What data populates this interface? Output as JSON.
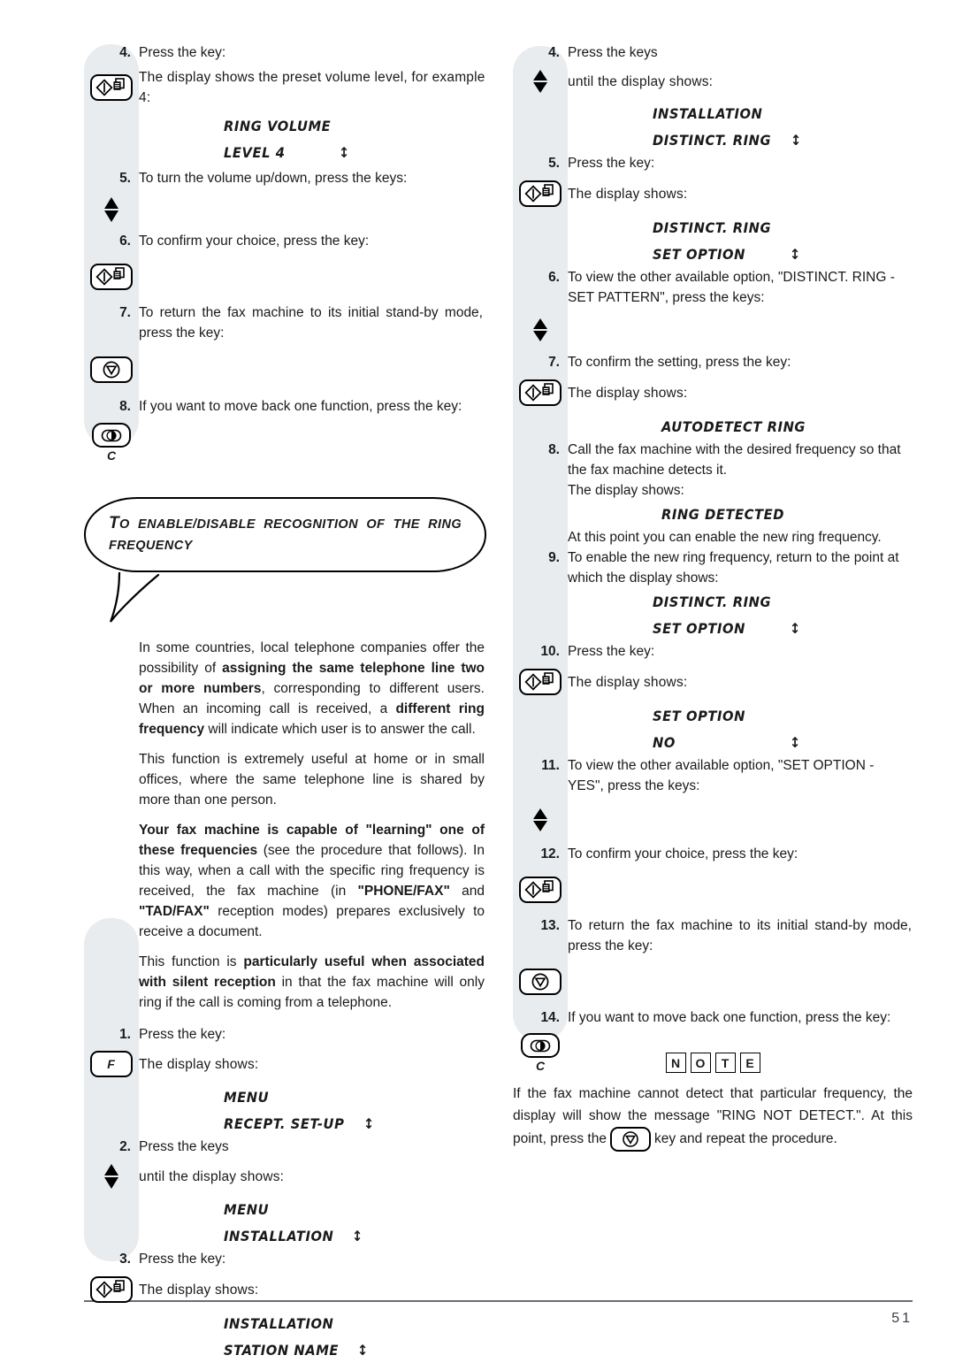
{
  "page": {
    "number": "51"
  },
  "left_column": {
    "steps": [
      {
        "num": "4.",
        "text": "Press the key:",
        "key_icon": "start-copy-key",
        "key_text": "The display shows the preset volume level, for example 4:",
        "display": [
          {
            "text": "RING VOLUME",
            "arrow": ""
          },
          {
            "text": "LEVEL 4",
            "arrow": "↕"
          }
        ]
      },
      {
        "num": "5.",
        "text": "To turn the volume up/down, press the keys:",
        "key_icon": "up-down-arrow-keys",
        "key_text": "",
        "display": []
      },
      {
        "num": "6.",
        "text": "To confirm your choice, press the key:",
        "key_icon": "start-copy-key",
        "key_text": "",
        "display": []
      },
      {
        "num": "7.",
        "text": "To return the fax machine to its initial stand-by mode, press the key:",
        "key_icon": "stop-key",
        "key_text": "",
        "display": []
      },
      {
        "num": "8.",
        "text": "If you want to move back one function, press the key:",
        "key_icon": "c-clear-key",
        "key_text": "",
        "display": []
      }
    ],
    "bubble_title_first_letter": "T",
    "bubble_title_rest": "O ENABLE/DISABLE RECOGNITION OF THE RING FREQUENCY",
    "paragraphs": [
      [
        {
          "t": "In some countries, local telephone companies offer the possibility of ",
          "b": false
        },
        {
          "t": "assigning the same telephone line two or more numbers",
          "b": true
        },
        {
          "t": ", corresponding to different users. When an incoming call is received, a ",
          "b": false
        },
        {
          "t": "different ring frequency",
          "b": true
        },
        {
          "t": " will indicate which user is to answer the call.",
          "b": false
        }
      ],
      [
        {
          "t": "This function is extremely useful at home or in small offices, where the same telephone line is shared by more than one person.",
          "b": false
        }
      ],
      [
        {
          "t": "Your fax machine is capable of \"learning\" one of these frequencies",
          "b": true
        },
        {
          "t": " (see the procedure that follows). In this way, when a call with the specific ring frequency is received, the fax machine (in ",
          "b": false
        },
        {
          "t": "\"PHONE/FAX\"",
          "b": true
        },
        {
          "t": " and ",
          "b": false
        },
        {
          "t": "\"TAD/FAX\"",
          "b": true
        },
        {
          "t": " reception modes) prepares exclusively to receive a document.",
          "b": false
        }
      ],
      [
        {
          "t": "This function is ",
          "b": false
        },
        {
          "t": "particularly useful when associated with silent reception",
          "b": true
        },
        {
          "t": " in that the fax machine will only ring if the call is coming from a telephone.",
          "b": false
        }
      ]
    ],
    "steps2": [
      {
        "num": "1.",
        "text": "Press the key:",
        "key_icon": "f-function-key",
        "key_text": "The display shows:",
        "display": [
          {
            "text": "MENU",
            "arrow": ""
          },
          {
            "text": "RECEPT. SET-UP",
            "arrow": "↕"
          }
        ]
      },
      {
        "num": "2.",
        "text": "Press the keys",
        "key_icon": "up-down-arrow-keys",
        "key_text": "until the display shows:",
        "display": [
          {
            "text": "MENU",
            "arrow": ""
          },
          {
            "text": "INSTALLATION",
            "arrow": "↕"
          }
        ]
      },
      {
        "num": "3.",
        "text": "Press the key:",
        "key_icon": "start-copy-key",
        "key_text": "The display shows:",
        "display": [
          {
            "text": "INSTALLATION",
            "arrow": ""
          },
          {
            "text": "STATION NAME",
            "arrow": "↕"
          }
        ]
      }
    ]
  },
  "right_column": {
    "steps": [
      {
        "num": "4.",
        "text": "Press the keys",
        "key_icon": "up-down-arrow-keys",
        "key_text": "until the display shows:",
        "display": [
          {
            "text": "INSTALLATION",
            "arrow": ""
          },
          {
            "text": "DISTINCT. RING",
            "arrow": "↕"
          }
        ]
      },
      {
        "num": "5.",
        "text": "Press the key:",
        "key_icon": "start-copy-key",
        "key_text": "The display shows:",
        "display": [
          {
            "text": "DISTINCT. RING",
            "arrow": ""
          },
          {
            "text": "SET OPTION",
            "arrow": "↕"
          }
        ]
      },
      {
        "num": "6.",
        "text": "To view the other available option, \"DISTINCT. RING - SET PATTERN\", press the keys:",
        "key_icon": "up-down-arrow-keys",
        "key_text": "",
        "display": []
      },
      {
        "num": "7.",
        "text": "To confirm the setting, press the key:",
        "key_icon": "start-copy-key",
        "key_text": "The display shows:",
        "display": [
          {
            "text": "AUTODETECT RING",
            "arrow": ""
          }
        ]
      },
      {
        "num": "8.",
        "text": "Call the fax machine with the desired frequency so that the fax machine detects it.",
        "key_icon": "",
        "key_text": "The display shows:",
        "display": [
          {
            "text": "RING DETECTED",
            "arrow": ""
          }
        ],
        "after": "At this point you can enable the new ring frequency."
      },
      {
        "num": "9.",
        "text": "To enable the new ring frequency, return to the point at which the display shows:",
        "key_icon": "",
        "key_text": "",
        "display": [
          {
            "text": "DISTINCT. RING",
            "arrow": ""
          },
          {
            "text": "SET OPTION",
            "arrow": "↕"
          }
        ]
      },
      {
        "num": "10.",
        "text": "Press the key:",
        "key_icon": "start-copy-key",
        "key_text": "The display shows:",
        "display": [
          {
            "text": "SET OPTION",
            "arrow": ""
          },
          {
            "text": "NO",
            "arrow": "↕"
          }
        ]
      },
      {
        "num": "11.",
        "text": "To view the other available option, \"SET OPTION - YES\", press the keys:",
        "key_icon": "up-down-arrow-keys",
        "key_text": "",
        "display": []
      },
      {
        "num": "12.",
        "text": "To confirm your choice, press the key:",
        "key_icon": "start-copy-key",
        "key_text": "",
        "display": []
      },
      {
        "num": "13.",
        "text": "To return the fax machine to its initial stand-by mode, press the key:",
        "key_icon": "stop-key",
        "key_text": "",
        "display": []
      },
      {
        "num": "14.",
        "text": "If you want to move back one function, press the key:",
        "key_icon": "c-clear-key",
        "key_text": "",
        "display": []
      }
    ],
    "note": {
      "letters": [
        "N",
        "O",
        "T",
        "E"
      ],
      "line1": "If the fax machine cannot detect that particular frequency, the display will show the message \"RING NOT DETECT.\". At this",
      "line2_before": "point, press the",
      "line2_after": "key and repeat the procedure.",
      "inline_key_icon": "stop-key"
    }
  },
  "keys": {
    "f_label": "F",
    "c_label": "C"
  }
}
